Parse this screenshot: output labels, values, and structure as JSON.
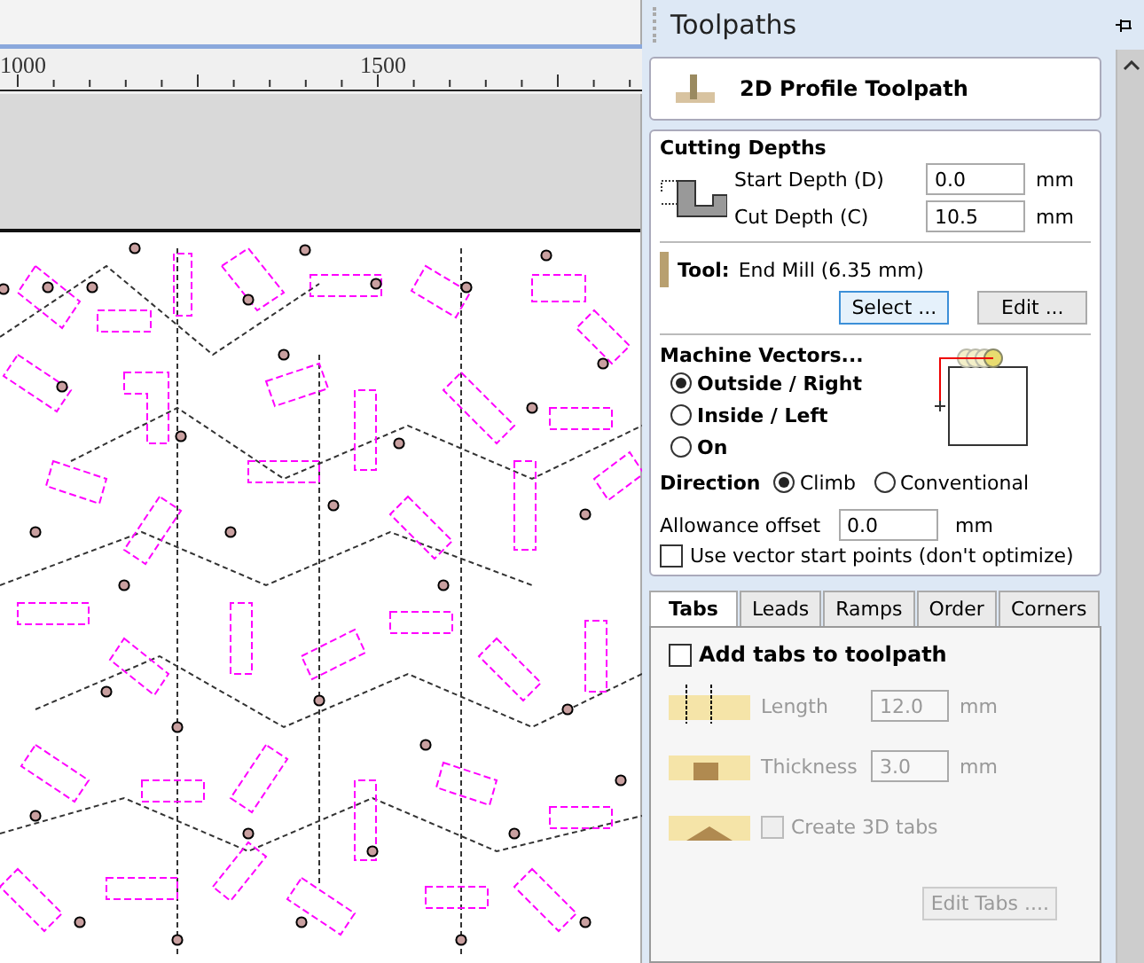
{
  "ruler": {
    "labels": [
      "1000",
      "1500"
    ]
  },
  "panel": {
    "title": "Toolpaths"
  },
  "toolpath_header": {
    "title": "2D Profile Toolpath"
  },
  "cutting_depths": {
    "heading": "Cutting Depths",
    "fields": [
      {
        "label": "Start Depth (D)",
        "value": "0.0",
        "unit": "mm"
      },
      {
        "label": "Cut Depth (C)",
        "value": "10.5",
        "unit": "mm"
      }
    ]
  },
  "tool": {
    "label": "Tool:",
    "name": "End Mill (6.35 mm)",
    "buttons": [
      {
        "label": "Select ...",
        "focused": true
      },
      {
        "label": "Edit ...",
        "focused": false
      }
    ]
  },
  "machine_vectors": {
    "heading": "Machine Vectors...",
    "options": [
      {
        "label": "Outside / Right",
        "selected": true
      },
      {
        "label": "Inside / Left",
        "selected": false
      },
      {
        "label": "On",
        "selected": false
      }
    ]
  },
  "direction": {
    "label": "Direction",
    "options": [
      {
        "label": "Climb",
        "selected": true
      },
      {
        "label": "Conventional",
        "selected": false
      }
    ]
  },
  "allowance": {
    "label": "Allowance offset",
    "value": "0.0",
    "unit": "mm"
  },
  "vector_start": {
    "label": "Use vector start points (don't optimize)",
    "checked": false
  },
  "tabs": [
    {
      "label": "Tabs",
      "selected": true
    },
    {
      "label": "Leads",
      "selected": false
    },
    {
      "label": "Ramps",
      "selected": false
    },
    {
      "label": "Order",
      "selected": false
    },
    {
      "label": "Corners",
      "selected": false
    }
  ],
  "tab_content": {
    "add_tabs": {
      "label": "Add tabs to toolpath",
      "checked": false
    },
    "fields": [
      {
        "label": "Length",
        "value": "12.0",
        "unit": "mm",
        "disabled": true
      },
      {
        "label": "Thickness",
        "value": "3.0",
        "unit": "mm",
        "disabled": true
      }
    ],
    "create_3d": {
      "label": "Create 3D tabs",
      "checked": false,
      "disabled": true
    },
    "edit_button": {
      "label": "Edit Tabs ....",
      "disabled": true
    }
  }
}
